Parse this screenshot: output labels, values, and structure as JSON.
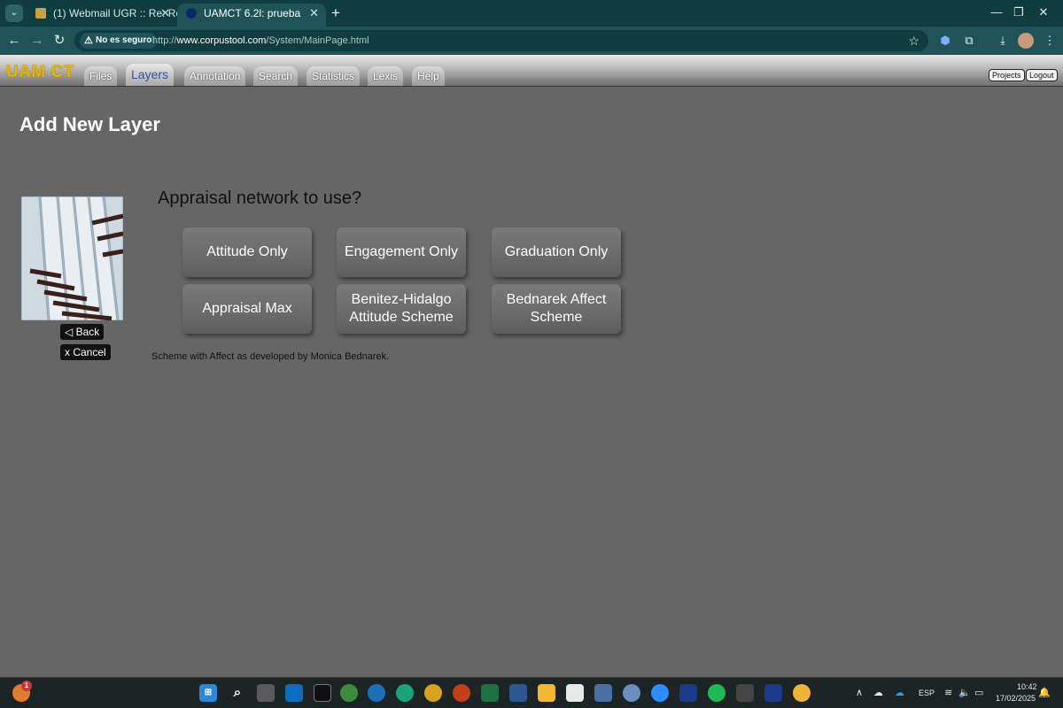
{
  "browser": {
    "tabs": [
      {
        "title": "(1) Webmail UGR :: Re: Retrospe"
      },
      {
        "title": "UAMCT 6.2l: prueba"
      }
    ],
    "new_tab": "+",
    "security_label": "No es seguro",
    "url_prefix": "http://",
    "url_domain": "www.corpustool.com",
    "url_path": "/System/MainPage.html"
  },
  "app": {
    "logo": "UAM CT",
    "menu": [
      "Files",
      "Layers",
      "Annotation",
      "Search",
      "Statistics",
      "Lexis",
      "Help"
    ],
    "active_menu": "Layers",
    "projects_label": "Projects",
    "logout_label": "Logout"
  },
  "page": {
    "title": "Add New Layer",
    "back_label": "◁ Back",
    "cancel_label": "x Cancel",
    "question": "Appraisal network to use?",
    "options": [
      {
        "label": "Attitude Only"
      },
      {
        "label": "Engagement Only"
      },
      {
        "label": "Graduation Only"
      },
      {
        "label": "Appraisal Max"
      },
      {
        "label": "Benitez-Hidalgo Attitude Scheme"
      },
      {
        "label": "Bednarek Affect Scheme"
      }
    ],
    "description": "Scheme with Affect as developed by Monica Bednarek."
  },
  "taskbar": {
    "notification_count": "1",
    "language": "ESP",
    "time": "10:42",
    "date": "17/02/2025"
  },
  "colors": {
    "page_bg": "#666666",
    "logo": "#e8b400",
    "active_tab_text": "#3a4fa3",
    "browser_chrome": "#1f5358"
  }
}
